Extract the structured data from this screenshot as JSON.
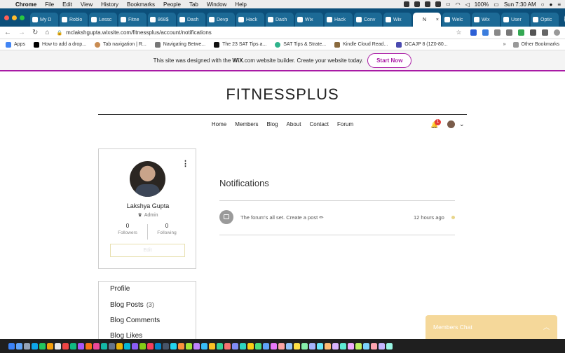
{
  "menubar": {
    "app": "Chrome",
    "items": [
      "File",
      "Edit",
      "View",
      "History",
      "Bookmarks",
      "People",
      "Tab",
      "Window",
      "Help"
    ],
    "battery": "100%",
    "clock": "Sun 7:30 AM"
  },
  "tabs": [
    {
      "label": "My D",
      "color": "#ffffff"
    },
    {
      "label": "Roblo",
      "color": "#ffffff"
    },
    {
      "label": "Lessc",
      "color": "#ffffff"
    },
    {
      "label": "Fitne",
      "color": "#ffffff"
    },
    {
      "label": "868$",
      "color": "#ffffff"
    },
    {
      "label": "Dash",
      "color": "#ffffff"
    },
    {
      "label": "Devp",
      "color": "#ffffff"
    },
    {
      "label": "Hack",
      "color": "#ffffff"
    },
    {
      "label": "Dash",
      "color": "#ffffff"
    },
    {
      "label": "Wix",
      "color": "#ffffff"
    },
    {
      "label": "Hack",
      "color": "#ffffff"
    },
    {
      "label": "Conv",
      "color": "#ffffff"
    },
    {
      "label": "Wix",
      "color": "#ffffff"
    },
    {
      "label": "N",
      "color": "#ffffff",
      "active": true
    },
    {
      "label": "Welc",
      "color": "#ffffff"
    },
    {
      "label": "Wix",
      "color": "#ffffff"
    },
    {
      "label": "User",
      "color": "#ffffff"
    },
    {
      "label": "Optic",
      "color": "#ffffff"
    }
  ],
  "address": {
    "url": "mclakshgupta.wixsite.com/fitnessplus/account/notifications"
  },
  "bookmarks": {
    "apps": "Apps",
    "items": [
      "How to add a drop...",
      "Tab navigation | R...",
      "Navigating Betwe...",
      "The 23 SAT Tips a...",
      "SAT Tips & Strate...",
      "Kindle Cloud Read...",
      "OCAJP 8 (1Z0-80..."
    ],
    "more": "»",
    "other": "Other Bookmarks"
  },
  "wix_banner": {
    "pre": "This site was designed with the ",
    "brand": "WiX",
    "post": ".com website builder. Create your website today.",
    "cta": "Start Now"
  },
  "site": {
    "title": "FITNESSPLUS",
    "nav": [
      "Home",
      "Members",
      "Blog",
      "About",
      "Contact",
      "Forum"
    ],
    "notification_count": "1"
  },
  "profile": {
    "name": "Lakshya Gupta",
    "role": "Admin",
    "followers_count": "0",
    "followers_label": "Followers",
    "following_count": "0",
    "following_label": "Following",
    "edit_label": "Edit"
  },
  "profile_menu": [
    {
      "label": "Profile",
      "count": ""
    },
    {
      "label": "Blog Posts",
      "count": "(3)"
    },
    {
      "label": "Blog Comments",
      "count": ""
    },
    {
      "label": "Blog Likes",
      "count": ""
    }
  ],
  "notifications": {
    "title": "Notifications",
    "items": [
      {
        "text": "The forum's all set. Create a post ✏",
        "time": "12 hours ago"
      }
    ]
  },
  "chat": {
    "label": "Members Chat"
  },
  "colors": {
    "wix_accent": "#a91ba5",
    "tabbar": "#0c4f7a",
    "chat": "#f5d89a",
    "badge": "#e53935"
  }
}
